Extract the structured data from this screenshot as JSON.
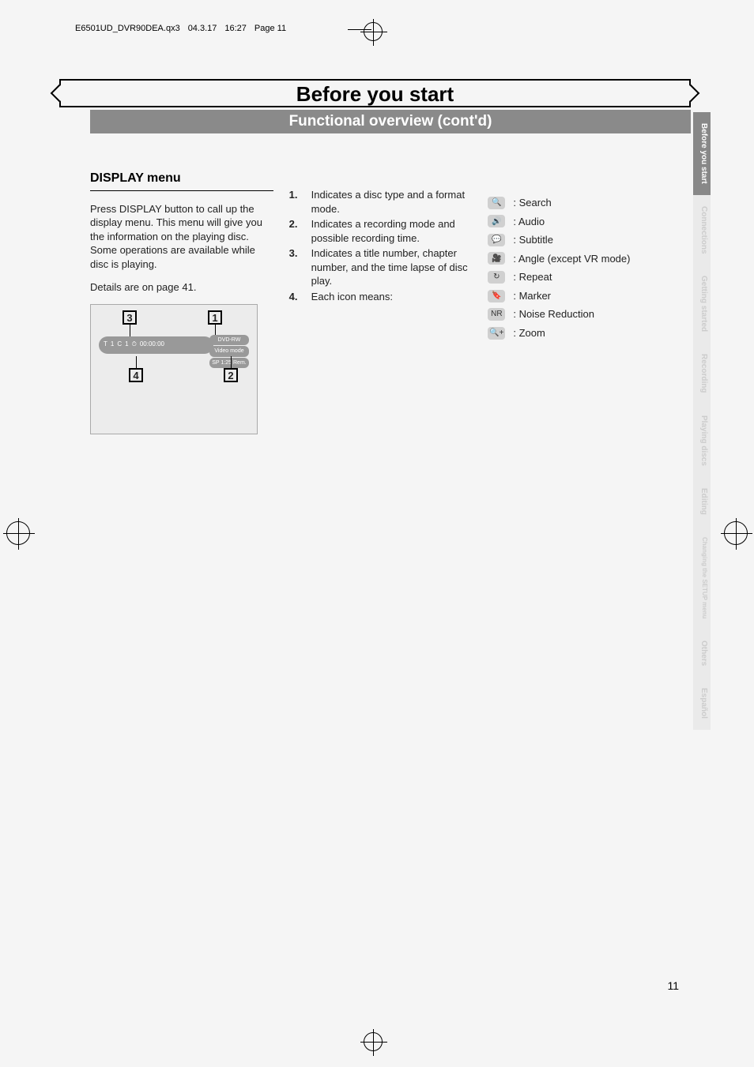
{
  "meta": {
    "filename": "E6501UD_DVR90DEA.qx3",
    "date": "04.3.17",
    "time": "16:27",
    "page": "Page 11"
  },
  "title": "Before you start",
  "subtitle": "Functional overview (cont'd)",
  "section_heading": "DISPLAY menu",
  "intro_para": "Press DISPLAY button to call up the display menu. This menu will give you the information on the playing disc. Some operations are available while disc is playing.",
  "details_line": "Details are on page 41.",
  "numbered": [
    {
      "n": "1.",
      "t": "Indicates a disc type and a format mode."
    },
    {
      "n": "2.",
      "t": "Indicates a recording mode and possible recording time."
    },
    {
      "n": "3.",
      "t": "Indicates a title number, chapter number, and the time lapse of disc play."
    },
    {
      "n": "4.",
      "t": "Each icon means:"
    }
  ],
  "icons": [
    {
      "glyph": "🔍",
      "label": ": Search"
    },
    {
      "glyph": "🔊",
      "label": ": Audio"
    },
    {
      "glyph": "💬",
      "label": ": Subtitle"
    },
    {
      "glyph": "🎥",
      "label": ": Angle (except VR mode)"
    },
    {
      "glyph": "↻",
      "label": ": Repeat"
    },
    {
      "glyph": "🔖",
      "label": ": Marker"
    },
    {
      "glyph": "NR",
      "label": ": Noise Reduction"
    },
    {
      "glyph": "🔍+",
      "label": ": Zoom"
    }
  ],
  "callouts": {
    "c1": "1",
    "c2": "2",
    "c3": "3",
    "c4": "4"
  },
  "diagram": {
    "t_label": "T",
    "t_val": "1",
    "c_label": "C",
    "c_val": "1",
    "time": "00:00:00",
    "right1": "DVD-RW",
    "right2": "Video mode",
    "right3": "SP 1:25 Rem."
  },
  "tabs": [
    {
      "label": "Before you start",
      "active": true
    },
    {
      "label": "Connections",
      "active": false
    },
    {
      "label": "Getting started",
      "active": false
    },
    {
      "label": "Recording",
      "active": false
    },
    {
      "label": "Playing discs",
      "active": false
    },
    {
      "label": "Editing",
      "active": false
    },
    {
      "label": "Changing the SETUP menu",
      "active": false
    },
    {
      "label": "Others",
      "active": false
    },
    {
      "label": "Español",
      "active": false
    }
  ],
  "page_number": "11"
}
